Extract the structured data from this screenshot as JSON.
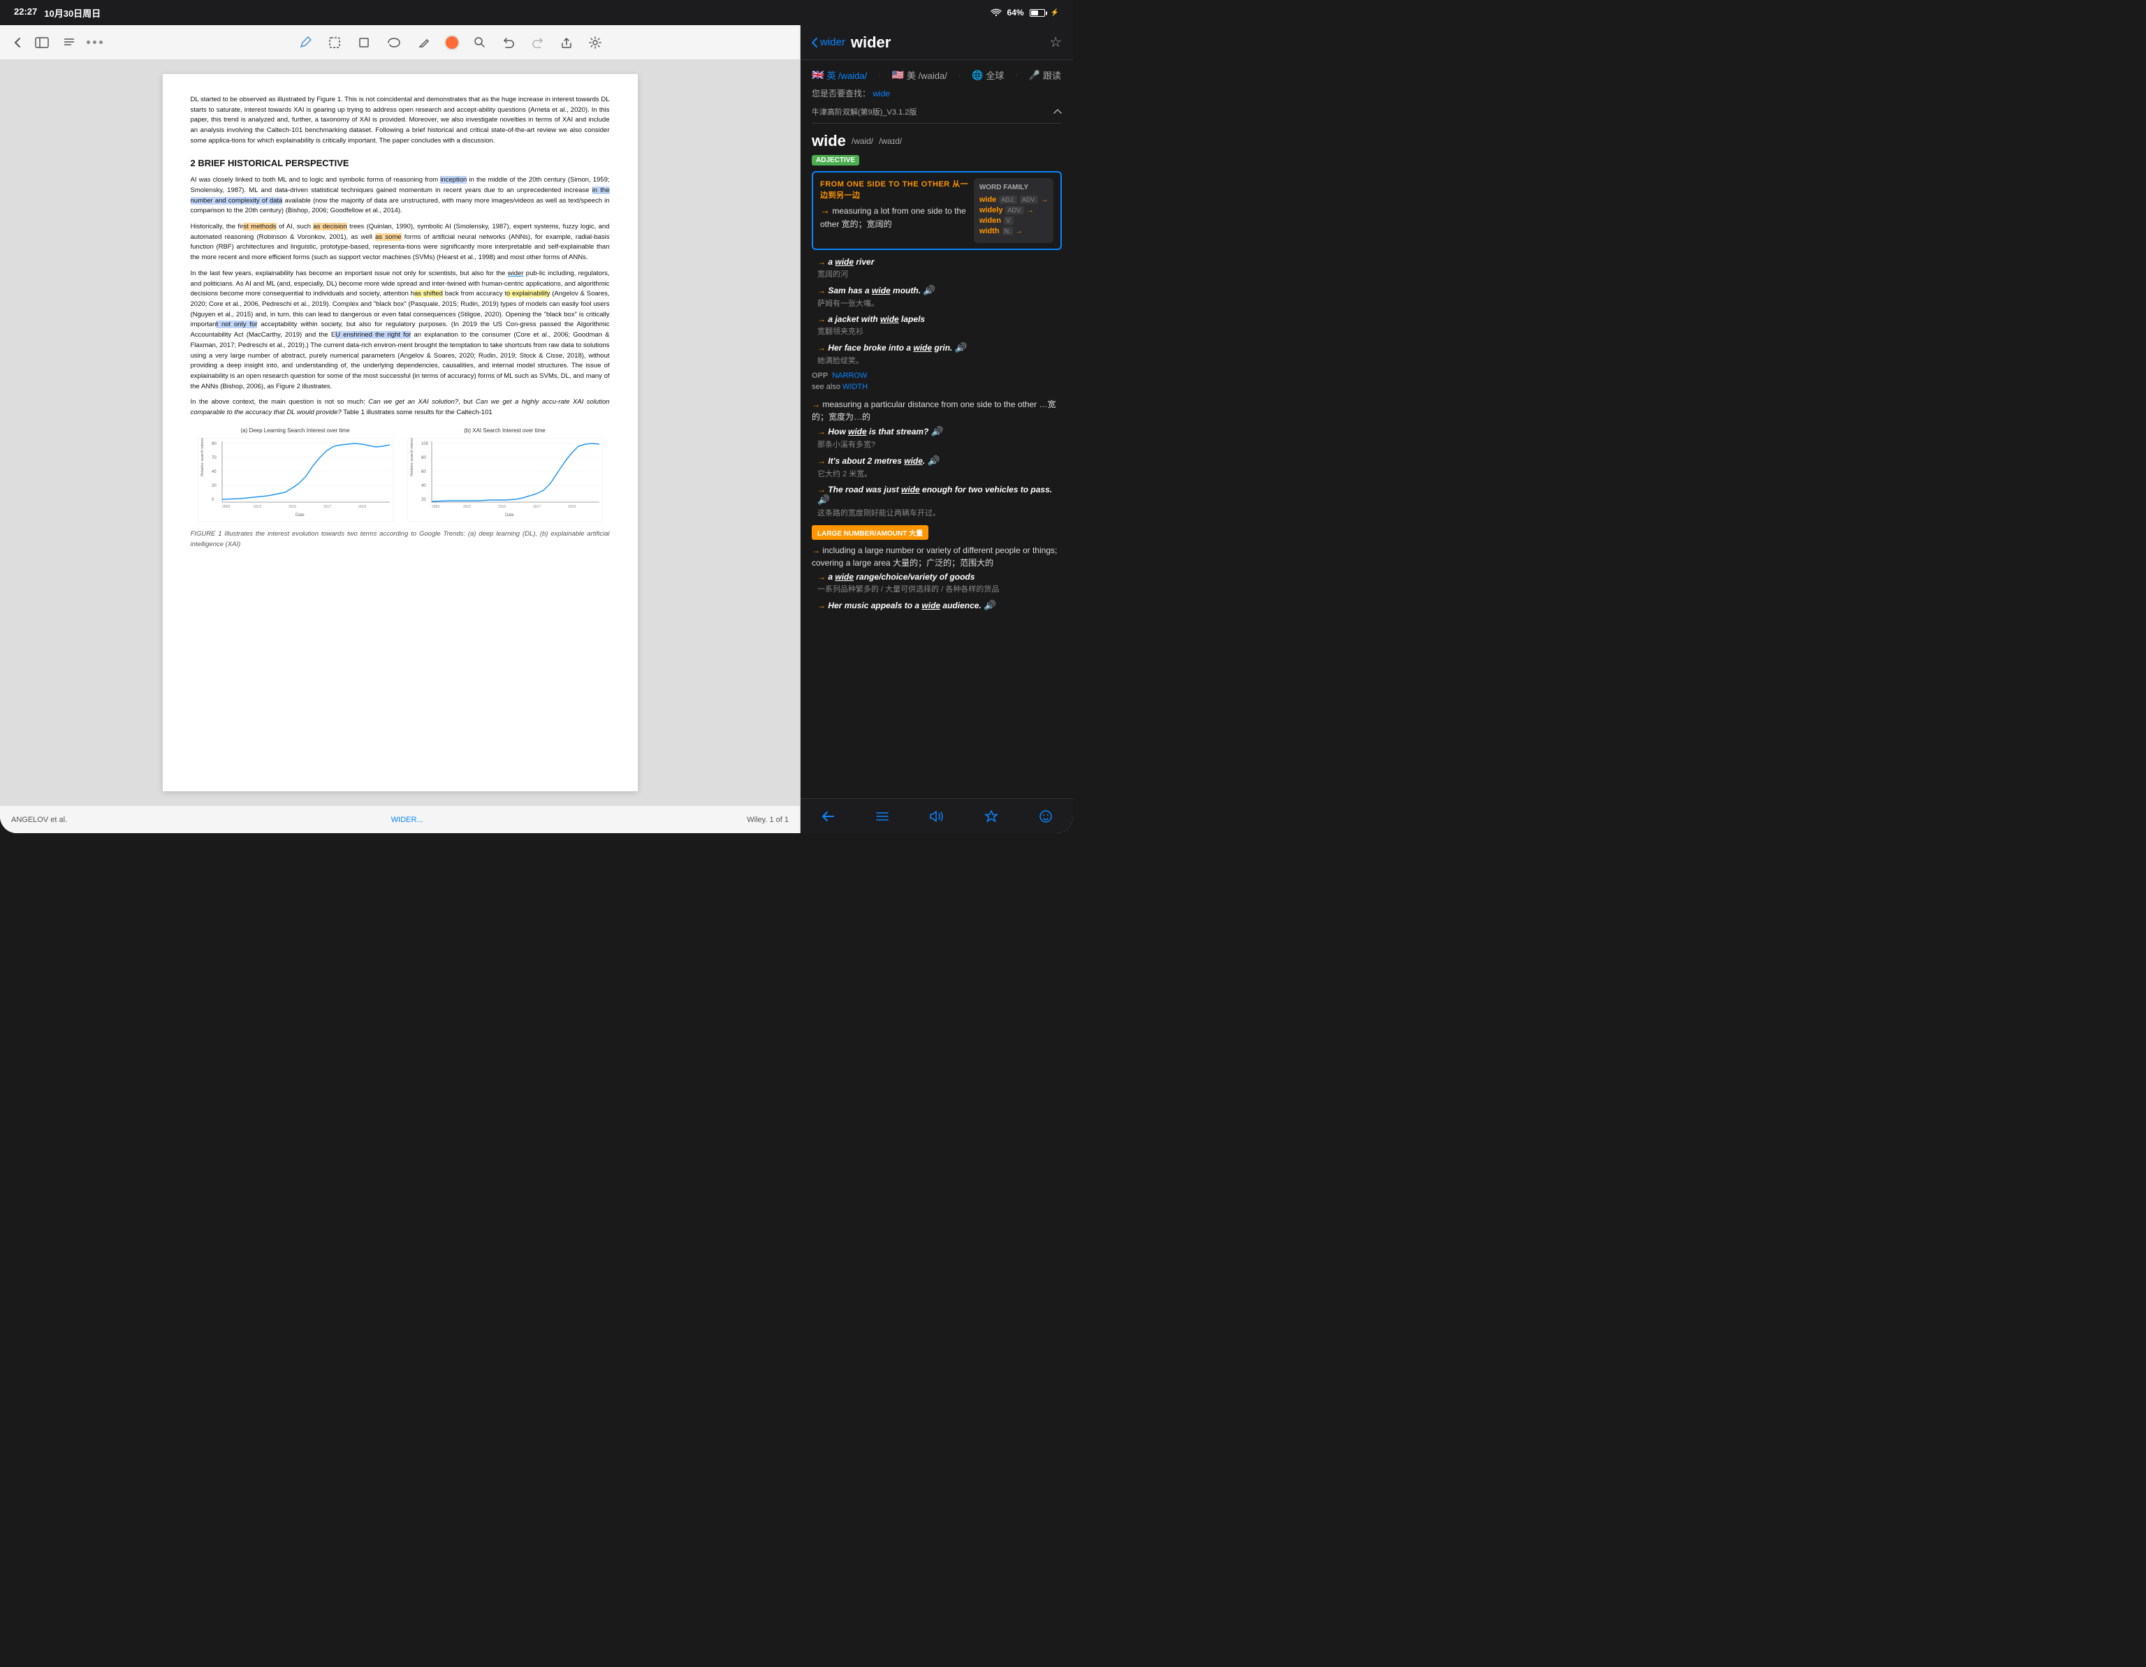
{
  "statusBar": {
    "time": "22:27",
    "date": "10月30日周日",
    "wifiLabel": "WiFi",
    "batteryPercent": "64%"
  },
  "pdfToolbar": {
    "backLabel": "‹",
    "sidebarLabel": "⊞",
    "textLabel": "≡",
    "dotsLabel": "•••",
    "pencilLabel": "✏",
    "selectionLabel": "⬚",
    "cropLabel": "⬜",
    "lasso": "⌒",
    "eraser": "◎",
    "penColor": "orange",
    "search": "🔍",
    "undo": "↩",
    "redo": "↪",
    "share": "↑",
    "settings": "⚙"
  },
  "pdfContent": {
    "intro": "DL started to be observed as illustrated by Figure 1. This is not coincidental and demonstrates that as the huge increase in interest towards DL starts to saturate, interest towards XAI is gearing up trying to address open research and accept-ability questions (Arrieta et al., 2020). In this paper, this trend is analyzed and, further, a taxonomy of XAI is provided. Moreover, we also investigate novelties in terms of XAI and include an analysis involving the Caltech-101 benchmarking dataset. Following a brief historical and critical state-of-the-art review we also consider some applica-tions for which explainability is critically important. The paper concludes with a discussion.",
    "section2Title": "2   BRIEF HISTORICAL PERSPECTIVE",
    "para1": "AI was closely linked to both ML and to logic and symbolic forms of reasoning from inception in the middle of the 20th century (Simon, 1959; Smolensky, 1987). ML and data-driven statistical techniques gained momentum in recent years due to an unprecedented increase in the number and complexity of data available (now the majority of data are unstructured, with many more images/videos as well as text/speech in comparison to the 20th century) (Bishop, 2006; Goodfellow et al., 2014).",
    "para2": "Historically, the first methods of AI, such as decision trees (Quinlan, 1990), symbolic AI (Smolensky, 1987), expert systems, fuzzy logic, and automated reasoning (Robinson & Voronkov, 2001), as well as some forms of artificial neural networks (ANNs), for example, radial-basis function (RBF) architectures and linguistic, prototype-based, representa-tions were significantly more interpretable and self-explainable than the more recent and more efficient forms (such as support vector machines (SVMs) (Hearst et al., 1998) and most other forms of ANNs.",
    "para3": "In the last few years, explainability has become an important issue not only for scientists, but also for the wider pub-lic including, regulators, and politicians. As AI and ML (and, especially, DL) become more wide spread and inter-twined with human-centric applications, and algorithmic decisions become more consequential to individuals and society, attention has shifted back from accuracy to explainability (Angelov & Soares, 2020; Core et al., 2006, Pedreschi et al., 2019). Complex and \"black box\" (Pasquale, 2015; Rudin, 2019) types of models can easily fool users (Nguyen et al., 2015) and, in turn, this can lead to dangerous or even fatal consequences (Stilgoe, 2020). Opening the \"black box\" is critically important not only for acceptability within society, but also for regulatory purposes. (In 2019 the US Con-gress passed the Algorithmic Accountability Act (MacCarthy, 2019) and the EU enshrined the right for an explanation to the consumer (Core et al., 2006; Goodman & Flaxman, 2017; Pedreschi et al., 2019).) The current data-rich environ-ment brought the temptation to take shortcuts from raw data to solutions using a very large number of abstract, purely numerical parameters (Angelov & Soares, 2020; Rudin, 2019; Stock & Cisse, 2018), without providing a deep insight into, and understanding of, the underlying dependencies, causalities, and internal model structures. The issue of explainability is an open research question for some of the most successful (in terms of accuracy) forms of ML such as SVMs, DL, and many of the ANNs (Bishop, 2006), as Figure 2 illustrates.",
    "para4": "In the above context, the main question is not so much: Can we get an XAI solution?, but Can we get a highly accu-rate XAI solution comparable to the accuracy that DL would provide? Table 1 illustrates some results for the Caltech-101",
    "chartCaption": "FIGURE 1   Illustrates the interest evolution towards two terms according to Google Trends: (a) deep learning (DL), (b) explainable artificial intelligence (XAI)",
    "chartATitle": "(a)  Deep Learning Search Interest over time",
    "chartBTitle": "(b)  XAI Search Interest over time",
    "bottomBarLeft": "ANGELOV et al.",
    "bottomBarRight": "WIDER...",
    "bottomBarPage": "Wiley. 1 of 1"
  },
  "dictionary": {
    "backLabel": "wider",
    "title": "wider",
    "starLabel": "☆",
    "langOptions": [
      {
        "flag": "🇬🇧",
        "label": "英 /waida/",
        "active": true
      },
      {
        "flag": "🇺🇸",
        "label": "美 /waida/",
        "active": false
      },
      {
        "flag": "🌐",
        "label": "全球",
        "active": false
      },
      {
        "flag": "🎤",
        "label": "跟读",
        "active": false
      }
    ],
    "searchHint": "您是否要查找：",
    "searchHintWord": "wide",
    "dictSource": "牛津高阶双解(第9版)_V3.1.2版",
    "headword": "wide",
    "phonetics": [
      "/waid/",
      "/waɪd/"
    ],
    "posAdj": "ADJECTIVE",
    "comparisonLabel": "FROM ONE SIDE TO THE OTHER 从一边到另一边",
    "measuringDef": "measuring a lot from one side to the other 宽的；宽阔的",
    "examples": [
      {
        "text": "→ a wide river",
        "zh": "宽阔的河"
      },
      {
        "text": "→ Sam has a wide mouth.",
        "zh": "萨姆有一张大嘴。"
      },
      {
        "text": "→ a jacket with wide lapels",
        "zh": "宽翻领夹克衫"
      },
      {
        "text": "→ Her face broke into a wide grin.",
        "zh": "她满脸绽笑。"
      }
    ],
    "oppLabel": "OPP",
    "oppWord": "NARROW",
    "seeAlsoLabel": "see also",
    "seeAlsoWord": "WIDTH",
    "def2Label": "measuring a particular distance from one side to the other …宽的；宽度为…的",
    "def2Examples": [
      {
        "text": "→ How wide is that stream?",
        "zh": "那条小溪有多宽?"
      },
      {
        "text": "→ It's about 2 metres wide.",
        "zh": "它大约 2 米宽。"
      },
      {
        "text": "→ The road was just wide enough for two vehicles to pass.",
        "zh": "这条路的宽度刚好能让两辆车开过。"
      }
    ],
    "sectionBadge": "LARGE NUMBER/AMOUNT 大量",
    "def3Label": "including a large number or variety of different people or things; covering a large area 大量的；广泛的；范围大的",
    "def3Examples": [
      {
        "text": "→ a wide range/choice/variety of goods",
        "zh": "一系列品种繁多的 / 大量可供选择的 / 各种各样的货品"
      },
      {
        "text": "→ Her music appeals to a wide audience.",
        "zh": ""
      }
    ],
    "wordFamilyTitle": "WORD FAMILY",
    "wordFamilyItems": [
      {
        "word": "wide",
        "pos": [
          "ADJ",
          "ADV"
        ]
      },
      {
        "word": "widely",
        "pos": [
          "ADV"
        ]
      },
      {
        "word": "widen",
        "pos": [
          "V"
        ]
      },
      {
        "word": "width",
        "pos": [
          "N"
        ]
      }
    ],
    "bottomBar": {
      "backLabel": "←",
      "listLabel": "☰",
      "audioLabel": "🔊",
      "starLabel": "☆",
      "emojiLabel": "☺"
    }
  }
}
